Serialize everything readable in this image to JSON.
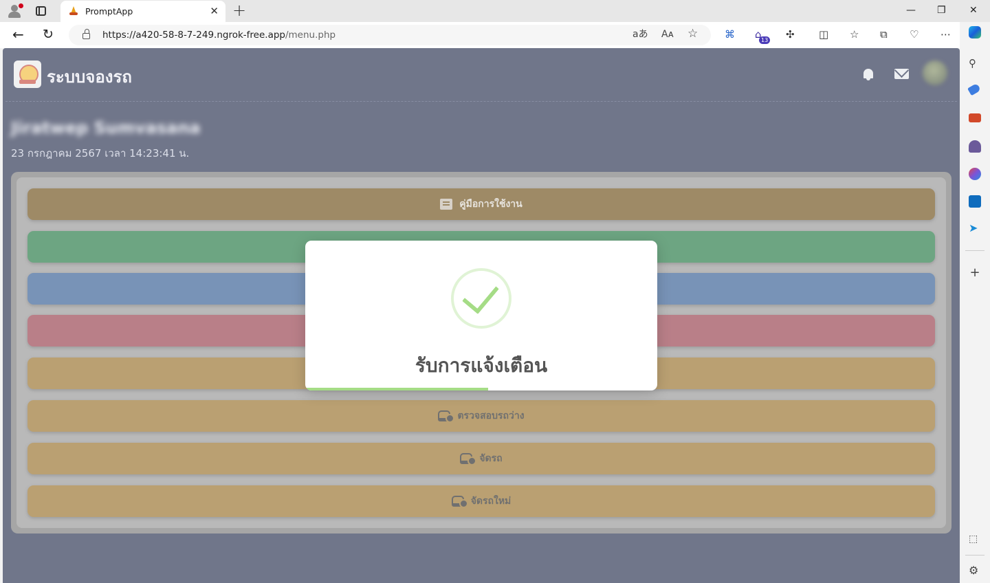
{
  "browser": {
    "tab_title": "PromptApp",
    "tab_close": "✕",
    "new_tab": "+",
    "url_host": "https://a420-58-8-7-249.ngrok-free.app",
    "url_path": "/menu.php",
    "read_aloud": "Aᴀ",
    "translate": "aあ",
    "extensions_badge": "13",
    "window": {
      "minimize": "—",
      "restore": "❐",
      "close": "✕"
    }
  },
  "header": {
    "app_title": "ระบบจองรถ",
    "username": "Jiratwep Sumvasana",
    "datetime": "23 กรกฎาคม 2567 เวลา 14:23:41 น."
  },
  "menu": {
    "items": [
      {
        "label": "คู่มือการใช้งาน",
        "icon": "book-icon",
        "bg": "#5e3c00",
        "fg": "#d8d2c8"
      },
      {
        "label": "",
        "icon": "",
        "bg": "#0d6a30",
        "fg": "#ffffff"
      },
      {
        "label": "",
        "icon": "",
        "bg": "#1e4b87",
        "fg": "#ffffff"
      },
      {
        "label": "",
        "icon": "",
        "bg": "#8a2a3a",
        "fg": "#ffffff"
      },
      {
        "label": "",
        "icon": "",
        "bg": "#8c6214",
        "fg": "#111111"
      },
      {
        "label": "ตรวจสอบรถว่าง",
        "icon": "car-search-icon",
        "bg": "#8c6214",
        "fg": "#111111"
      },
      {
        "label": "จัดรถ",
        "icon": "car-edit-icon",
        "bg": "#8c6214",
        "fg": "#111111"
      },
      {
        "label": "จัดรถใหม่",
        "icon": "car-refresh-icon",
        "bg": "#8c6214",
        "fg": "#111111"
      }
    ]
  },
  "modal": {
    "title": "รับการแจ้งเตือน",
    "icon": "success-check-icon",
    "accent": "#a5dc86",
    "timer_progress": 0.52
  }
}
